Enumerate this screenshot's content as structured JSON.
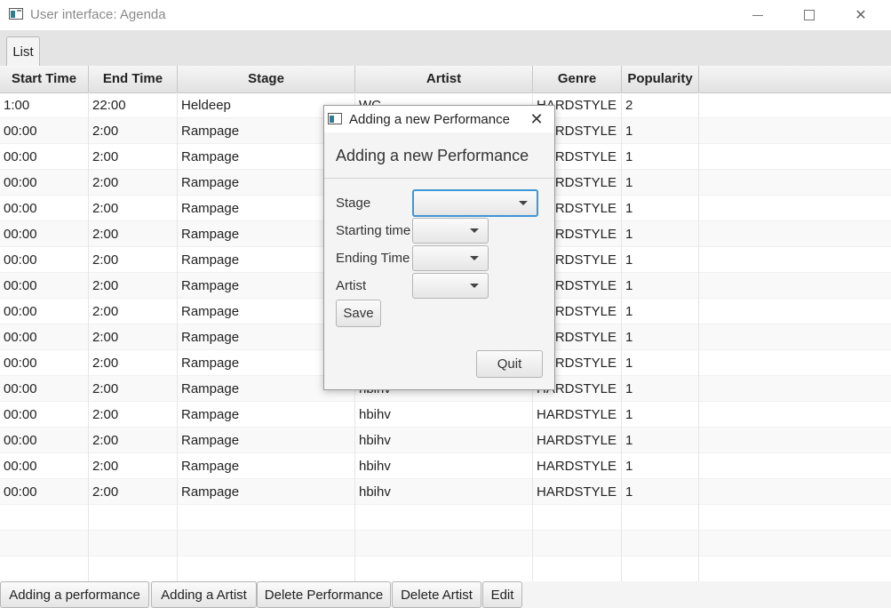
{
  "window": {
    "title": "User interface: Agenda"
  },
  "tabs": [
    {
      "label": "List"
    }
  ],
  "table": {
    "columns": [
      "Start Time",
      "End Time",
      "Stage",
      "Artist",
      "Genre",
      "Popularity"
    ],
    "rows": [
      [
        "1:00",
        "22:00",
        "Heldeep",
        "WC",
        "HARDSTYLE",
        "2"
      ],
      [
        "00:00",
        "2:00",
        "Rampage",
        "",
        "HARDSTYLE",
        "1"
      ],
      [
        "00:00",
        "2:00",
        "Rampage",
        "",
        "HARDSTYLE",
        "1"
      ],
      [
        "00:00",
        "2:00",
        "Rampage",
        "",
        "HARDSTYLE",
        "1"
      ],
      [
        "00:00",
        "2:00",
        "Rampage",
        "",
        "HARDSTYLE",
        "1"
      ],
      [
        "00:00",
        "2:00",
        "Rampage",
        "",
        "HARDSTYLE",
        "1"
      ],
      [
        "00:00",
        "2:00",
        "Rampage",
        "",
        "HARDSTYLE",
        "1"
      ],
      [
        "00:00",
        "2:00",
        "Rampage",
        "",
        "HARDSTYLE",
        "1"
      ],
      [
        "00:00",
        "2:00",
        "Rampage",
        "",
        "HARDSTYLE",
        "1"
      ],
      [
        "00:00",
        "2:00",
        "Rampage",
        "",
        "HARDSTYLE",
        "1"
      ],
      [
        "00:00",
        "2:00",
        "Rampage",
        "",
        "HARDSTYLE",
        "1"
      ],
      [
        "00:00",
        "2:00",
        "Rampage",
        "hbihv",
        "HARDSTYLE",
        "1"
      ],
      [
        "00:00",
        "2:00",
        "Rampage",
        "hbihv",
        "HARDSTYLE",
        "1"
      ],
      [
        "00:00",
        "2:00",
        "Rampage",
        "hbihv",
        "HARDSTYLE",
        "1"
      ],
      [
        "00:00",
        "2:00",
        "Rampage",
        "hbihv",
        "HARDSTYLE",
        "1"
      ],
      [
        "00:00",
        "2:00",
        "Rampage",
        "hbihv",
        "HARDSTYLE",
        "1"
      ]
    ]
  },
  "bottom_buttons": [
    "Adding a performance",
    "Adding a Artist",
    "Delete Performance",
    "Delete Artist",
    "Edit"
  ],
  "dialog": {
    "title": "Adding a new Performance",
    "header": "Adding a new Performance",
    "fields": [
      "Stage",
      "Starting time",
      "Ending Time",
      "Artist"
    ],
    "save_label": "Save",
    "quit_label": "Quit"
  },
  "colors": {
    "focus": "#3d96d6",
    "header_bg": "#e1e1e1",
    "alt_row": "#f9f9f9"
  }
}
